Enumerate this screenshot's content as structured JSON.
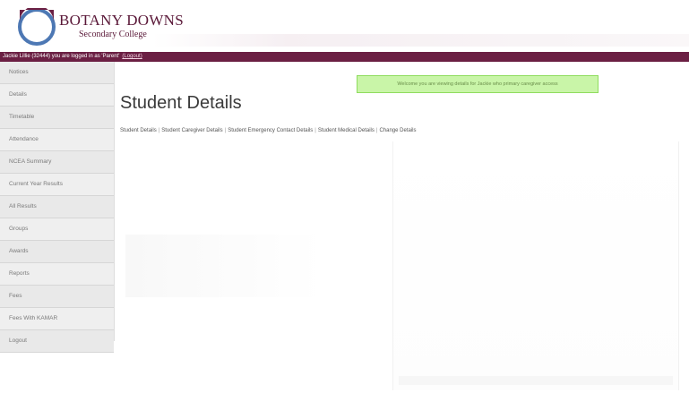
{
  "branding": {
    "title": "BOTANY DOWNS",
    "subtitle": "Secondary College",
    "logo_icon": "school-crest-icon",
    "brand_color": "#6b1f43",
    "logo_ring_color": "#4d78b4"
  },
  "statusbar": {
    "text": "Jackie Lillie (32444) you are logged in as 'Parent'",
    "logout_label": "(Logout)"
  },
  "sidebar": {
    "items": [
      {
        "label": "Notices"
      },
      {
        "label": "Details"
      },
      {
        "label": "Timetable"
      },
      {
        "label": "Attendance"
      },
      {
        "label": "NCEA Summary"
      },
      {
        "label": "Current Year Results"
      },
      {
        "label": "All Results"
      },
      {
        "label": "Groups"
      },
      {
        "label": "Awards"
      },
      {
        "label": "Reports"
      },
      {
        "label": "Fees"
      },
      {
        "label": "Fees With KAMAR"
      },
      {
        "label": "Logout"
      }
    ]
  },
  "main": {
    "welcome_message": "Welcome you are viewing details for Jackie who primary caregiver access",
    "page_title": "Student Details",
    "subnav": [
      {
        "label": "Student Details"
      },
      {
        "label": "Student Caregiver Details"
      },
      {
        "label": "Student Emergency Contact Details"
      },
      {
        "label": "Student Medical Details"
      },
      {
        "label": "Change Details"
      }
    ],
    "separator": "|"
  }
}
